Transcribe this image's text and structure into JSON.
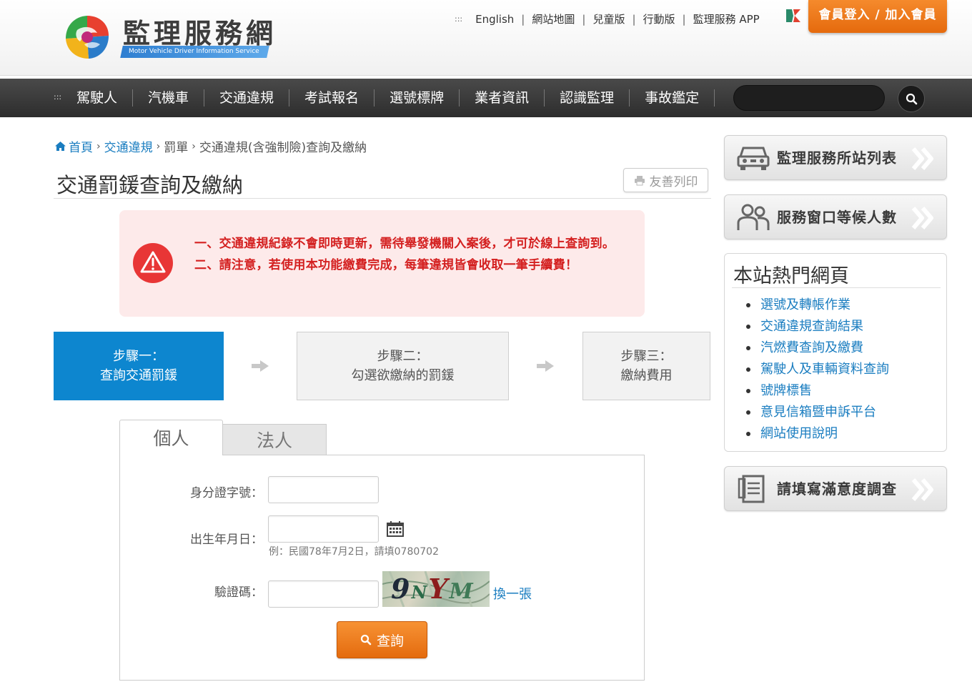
{
  "header": {
    "logo_title": "監理服務網",
    "logo_subtitle": "Motor Vehicle Driver Information Service",
    "top_links": [
      "English",
      "網站地圖",
      "兒童版",
      "行動版",
      "監理服務 APP"
    ],
    "member_button": "會員登入 / 加入會員"
  },
  "nav": {
    "items": [
      "駕駛人",
      "汽機車",
      "交通違規",
      "考試報名",
      "選號標牌",
      "業者資訊",
      "認識監理",
      "事故鑑定"
    ],
    "search_placeholder": ""
  },
  "breadcrumb": [
    "首頁",
    "交通違規",
    "罰單",
    "交通違規(含強制險)查詢及繳納"
  ],
  "page": {
    "title": "交通罰鍰查詢及繳納",
    "print_label": "友善列印"
  },
  "notice": {
    "line1": "一、交通違規紀錄不會即時更新，需待舉發機關入案後，才可於線上查詢到。",
    "line2": "二、請注意，若使用本功能繳費完成，每筆違規皆會收取一筆手續費！"
  },
  "steps": [
    {
      "title": "步驟一：",
      "desc": "查詢交通罰鍰"
    },
    {
      "title": "步驟二：",
      "desc": "勾選欲繳納的罰鍰"
    },
    {
      "title": "步驟三：",
      "desc": "繳納費用"
    }
  ],
  "tabs": [
    "個人",
    "法人"
  ],
  "form": {
    "id_label": "身分證字號：",
    "id_value": "",
    "birth_label": "出生年月日：",
    "birth_value": "",
    "birth_hint": "例：民國78年7月2日，請填0780702",
    "captcha_label": "驗證碼：",
    "captcha_value": "",
    "captcha_text": "9NYM",
    "refresh_label": "換一張",
    "query_label": "查詢"
  },
  "sidebar": {
    "station_list": "監理服務所站列表",
    "queue_count": "服務窗口等候人數",
    "popular_title": "本站熱門網頁",
    "popular_links": [
      "選號及轉帳作業",
      "交通違規查詢結果",
      "汽燃費查詢及繳費",
      "駕駛人及車輛資料查詢",
      "號牌標售",
      "意見信箱暨申訴平台",
      "網站使用說明"
    ],
    "survey": "請填寫滿意度調查"
  },
  "colors": {
    "accent_blue": "#0d86cf",
    "link_blue": "#1a7dc0",
    "orange": "#e56a0d",
    "notice_red": "#d42020",
    "notice_bg": "#fdeaea"
  }
}
